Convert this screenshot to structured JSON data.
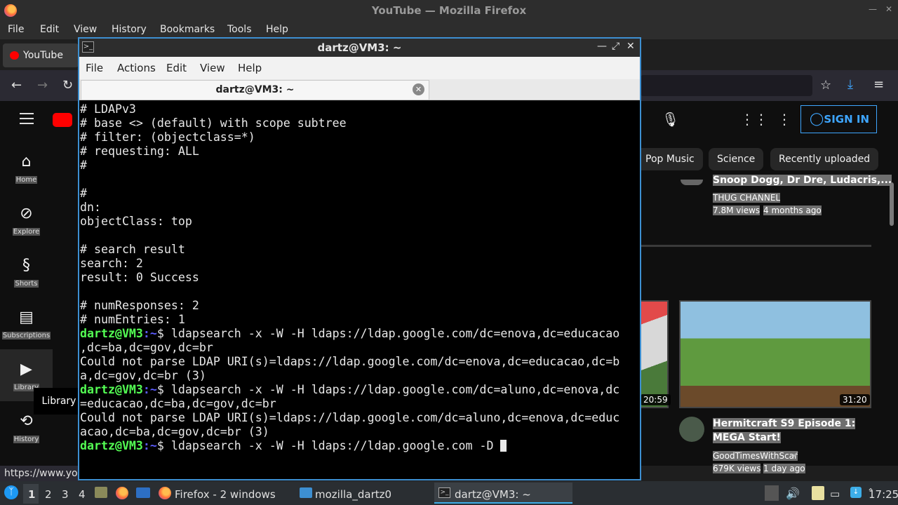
{
  "firefox": {
    "title": "YouTube — Mozilla Firefox",
    "menu": [
      "File",
      "Edit",
      "View",
      "History",
      "Bookmarks",
      "Tools",
      "Help"
    ],
    "tab_title": "YouTube",
    "status_url": "https://www.you"
  },
  "youtube": {
    "guide": [
      {
        "label": "Home",
        "icon": "home-icon"
      },
      {
        "label": "Explore",
        "icon": "compass-icon"
      },
      {
        "label": "Shorts",
        "icon": "shorts-icon"
      },
      {
        "label": "Subscriptions",
        "icon": "subscriptions-icon"
      },
      {
        "label": "Library",
        "icon": "library-icon"
      },
      {
        "label": "History",
        "icon": "history-icon"
      }
    ],
    "tooltip": "Library",
    "chips": [
      "Pop Music",
      "Science",
      "Recently uploaded"
    ],
    "sign_in": "SIGN IN",
    "video_top": {
      "title": "Snoop Dogg, Dr Dre, Ludacris,...",
      "channel": "THUG CHANNEL",
      "views": "7.8M views",
      "age": "4 months ago"
    },
    "video_left_duration": "20:59",
    "video_right": {
      "duration": "31:20",
      "title_line1": "Hermitcraft S9 Episode 1:",
      "title_line2": "MEGA Start!",
      "channel": "GoodTimesWithScar",
      "views": "679K views",
      "age": "1 day ago"
    }
  },
  "terminal": {
    "title": "dartz@VM3: ~",
    "menu": [
      "File",
      "Actions",
      "Edit",
      "View",
      "Help"
    ],
    "tab_title": "dartz@VM3: ~",
    "prompt_user": "dartz@VM3",
    "prompt_path": ":~",
    "lines": [
      {
        "t": "# LDAPv3"
      },
      {
        "t": "# base <> (default) with scope subtree"
      },
      {
        "t": "# filter: (objectclass=*)"
      },
      {
        "t": "# requesting: ALL"
      },
      {
        "t": "#"
      },
      {
        "t": ""
      },
      {
        "t": "#"
      },
      {
        "t": "dn:"
      },
      {
        "t": "objectClass: top"
      },
      {
        "t": ""
      },
      {
        "t": "# search result"
      },
      {
        "t": "search: 2"
      },
      {
        "t": "result: 0 Success"
      },
      {
        "t": ""
      },
      {
        "t": "# numResponses: 2"
      },
      {
        "t": "# numEntries: 1"
      },
      {
        "p": true,
        "t": "$ ldapsearch -x -W -H ldaps://ldap.google.com/dc=enova,dc=educacao"
      },
      {
        "t": ",dc=ba,dc=gov,dc=br"
      },
      {
        "t": "Could not parse LDAP URI(s)=ldaps://ldap.google.com/dc=enova,dc=educacao,dc=b"
      },
      {
        "t": "a,dc=gov,dc=br (3)"
      },
      {
        "p": true,
        "t": "$ ldapsearch -x -W -H ldaps://ldap.google.com/dc=aluno,dc=enova,dc"
      },
      {
        "t": "=educacao,dc=ba,dc=gov,dc=br"
      },
      {
        "t": "Could not parse LDAP URI(s)=ldaps://ldap.google.com/dc=aluno,dc=enova,dc=educ"
      },
      {
        "t": "acao,dc=ba,dc=gov,dc=br (3)"
      },
      {
        "p": true,
        "t": "$ ldapsearch -x -W -H ldaps://ldap.google.com -D ",
        "cursor": true
      }
    ]
  },
  "taskbar": {
    "desktops": [
      "1",
      "2",
      "3",
      "4"
    ],
    "tasks": [
      "Firefox - 2 windows",
      "mozilla_dartz0",
      "dartz@VM3: ~"
    ],
    "clock": "17:25"
  }
}
